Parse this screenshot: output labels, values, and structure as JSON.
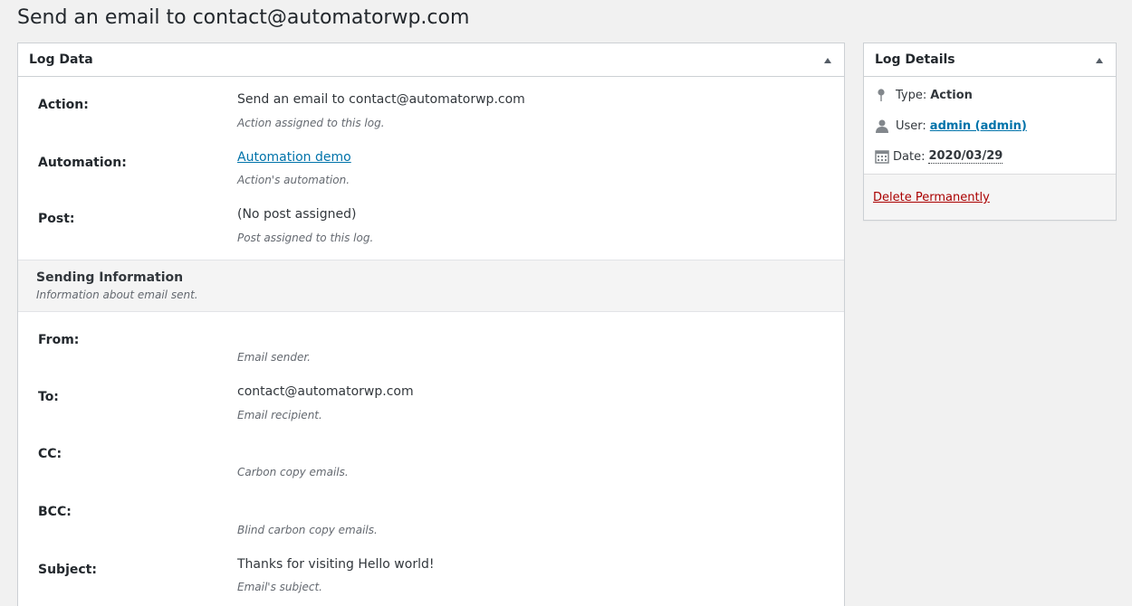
{
  "page": {
    "title": "Send an email to contact@automatorwp.com"
  },
  "log_data": {
    "title": "Log Data",
    "rows": [
      {
        "label": "Action:",
        "value": "Send an email to contact@automatorwp.com",
        "desc": "Action assigned to this log."
      },
      {
        "label": "Automation:",
        "value": "Automation demo",
        "desc": "Action's automation."
      },
      {
        "label": "Post:",
        "value": "(No post assigned)",
        "desc": "Post assigned to this log."
      }
    ],
    "section": {
      "title": "Sending Information",
      "desc": "Information about email sent."
    },
    "email_rows": [
      {
        "label": "From:",
        "value": "",
        "desc": "Email sender."
      },
      {
        "label": "To:",
        "value": "contact@automatorwp.com",
        "desc": "Email recipient."
      },
      {
        "label": "CC:",
        "value": "",
        "desc": "Carbon copy emails."
      },
      {
        "label": "BCC:",
        "value": "",
        "desc": "Blind carbon copy emails."
      },
      {
        "label": "Subject:",
        "value": "Thanks for visiting Hello world!",
        "desc": "Email's subject."
      }
    ]
  },
  "log_details": {
    "title": "Log Details",
    "type_label": "Type:",
    "type_value": "Action",
    "user_label": "User:",
    "user_value": "admin (admin)",
    "date_label": "Date:",
    "date_value": "2020/03/29",
    "delete_label": "Delete Permanently"
  },
  "icons": {
    "toggle": "triangle-up-icon",
    "type": "pin-icon",
    "user": "user-icon",
    "date": "calendar-icon"
  },
  "colors": {
    "link": "#0073aa",
    "delete": "#aa0000",
    "background": "#f1f1f1"
  }
}
